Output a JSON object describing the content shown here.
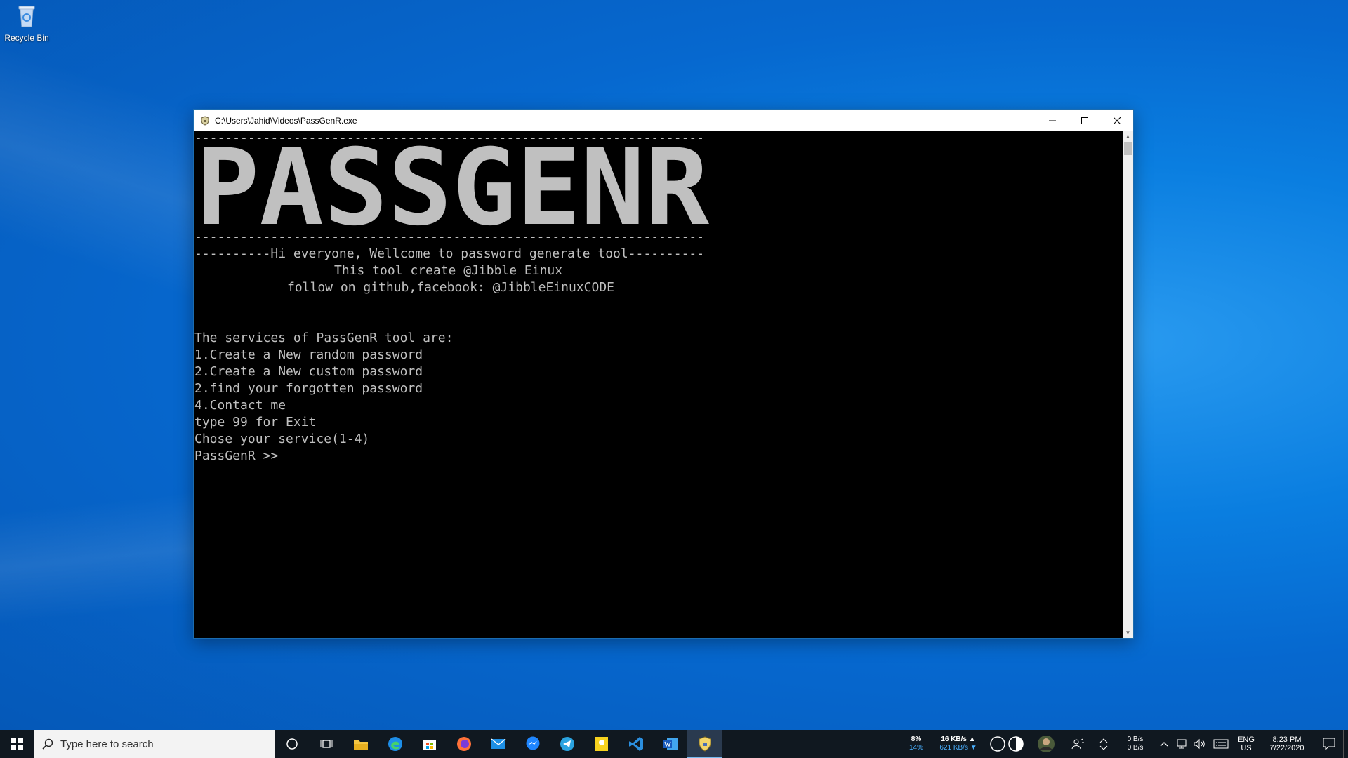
{
  "desktop": {
    "recycle_bin_label": "Recycle Bin"
  },
  "window": {
    "title": "C:\\Users\\Jahid\\Videos\\PassGenR.exe",
    "icon": "shield-icon",
    "controls": [
      "minimize-icon",
      "maximize-icon",
      "close-icon"
    ]
  },
  "console": {
    "separator": "-------------------------------------------------------------------",
    "banner": "PASSGENR",
    "welcome": "----------Hi everyone, Wellcome to password generate tool----------",
    "credit": "This tool create @Jibble Einux",
    "follow": "follow on github,facebook: @JibbleEinuxCODE",
    "services_header": "The services of PassGenR tool are:",
    "services": [
      "1.Create a New random password",
      "2.Create a New custom password",
      "2.find your forgotten password",
      "4.Contact me"
    ],
    "exit_hint": "type 99 for Exit",
    "choose": "Chose your service(1-4)",
    "prompt": "PassGenR >>"
  },
  "taskbar": {
    "search_placeholder": "Type here to search",
    "pinned": [
      "cortana-icon",
      "task-view-icon",
      "file-explorer-icon",
      "edge-icon",
      "store-icon",
      "firefox-icon",
      "mail-icon",
      "messenger-icon",
      "telegram-icon",
      "player-icon",
      "vscode-icon",
      "word-icon",
      "passgenr-icon"
    ],
    "cpu": "8%",
    "ram": "14%",
    "net_up": "16 KB/s",
    "net_down": "621 KB/s",
    "disk_read": "0 B/s",
    "disk_write": "0 B/s",
    "lang": "ENG",
    "region": "US",
    "time": "8:23 PM",
    "date": "7/22/2020"
  },
  "colors": {
    "console_text": "#c0c0c0",
    "console_bg": "#000000",
    "taskbar_bg": "#101820",
    "accent": "#0a7ee0"
  }
}
